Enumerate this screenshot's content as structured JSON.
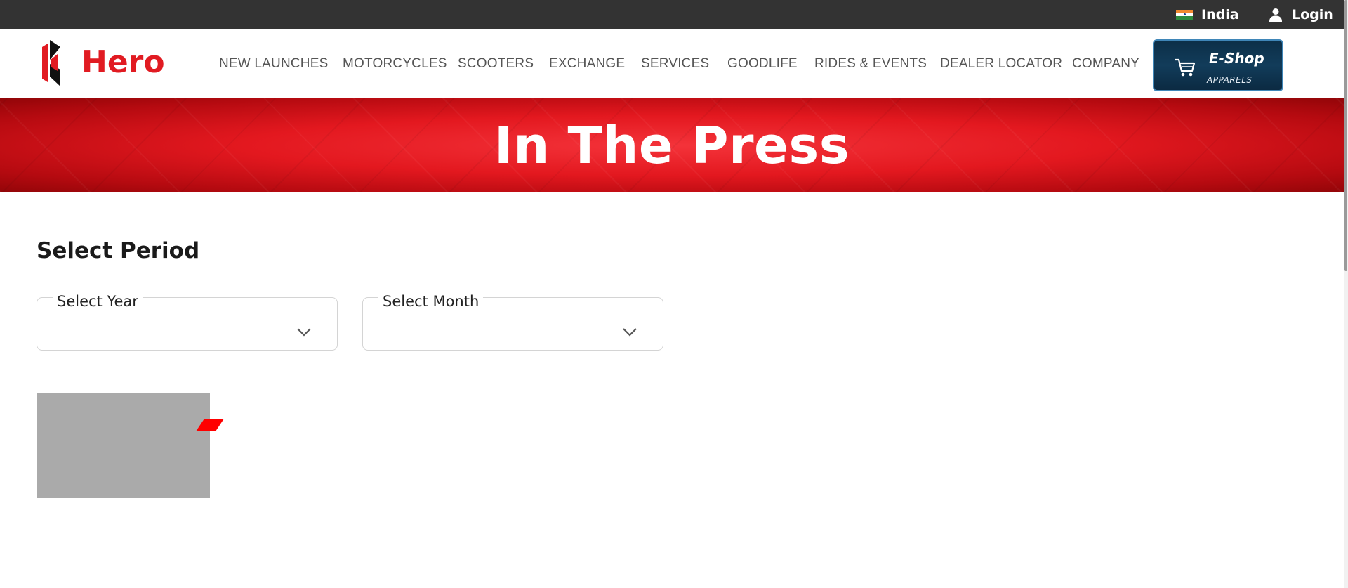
{
  "topbar": {
    "country_label": "India",
    "login_label": "Login",
    "flag_icon": "india-flag-icon",
    "user_icon": "user-icon",
    "background": "#333333"
  },
  "navbar": {
    "brand": "Hero",
    "items": [
      "NEW LAUNCHES",
      "MOTORCYCLES",
      "SCOOTERS",
      "EXCHANGE",
      "SERVICES",
      "GOODLIFE",
      "RIDES & EVENTS",
      "DEALER LOCATOR",
      "COMPANY"
    ],
    "eshop": {
      "title": "E-Shop",
      "subtitle": "APPARELS",
      "icon": "cart-icon"
    }
  },
  "banner": {
    "title": "In The Press",
    "color": "#e3181f"
  },
  "filters": {
    "section_title": "Select Period",
    "year": {
      "label": "Select Year",
      "value": ""
    },
    "month": {
      "label": "Select Month",
      "value": ""
    }
  },
  "colors": {
    "brand_red": "#e11b22",
    "thumb_gray": "#aaaaaa"
  }
}
